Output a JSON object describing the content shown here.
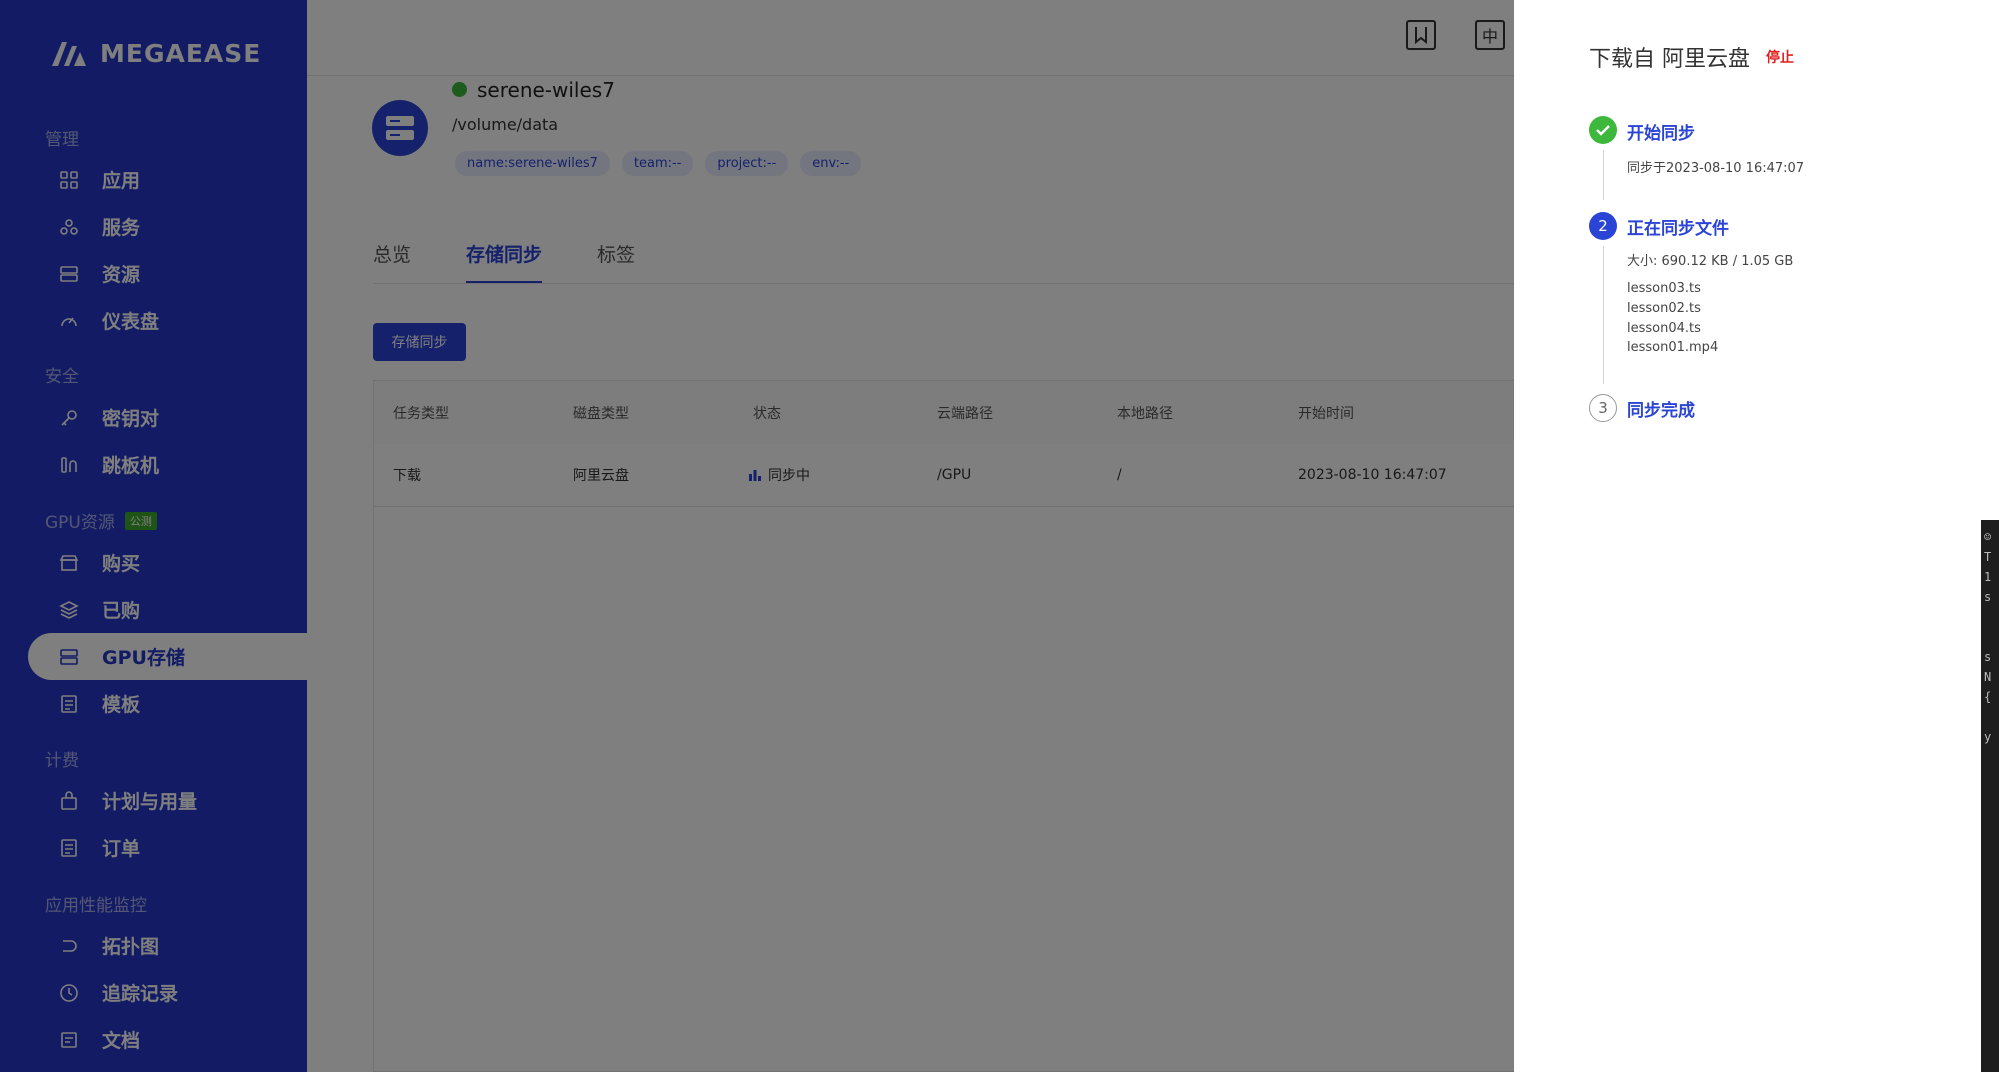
{
  "brand": {
    "name": "MEGAEASE"
  },
  "sidebar": {
    "sections": [
      {
        "label": "管理",
        "items": [
          {
            "label": "应用",
            "icon": "grid-icon"
          },
          {
            "label": "服务",
            "icon": "services-icon"
          },
          {
            "label": "资源",
            "icon": "resource-icon"
          },
          {
            "label": "仪表盘",
            "icon": "dashboard-icon"
          }
        ]
      },
      {
        "label": "安全",
        "items": [
          {
            "label": "密钥对",
            "icon": "key-icon"
          },
          {
            "label": "跳板机",
            "icon": "jump-server-icon"
          }
        ]
      },
      {
        "label": "GPU资源",
        "badge": "公测",
        "items": [
          {
            "label": "购买",
            "icon": "store-icon"
          },
          {
            "label": "已购",
            "icon": "layers-icon"
          },
          {
            "label": "GPU存储",
            "icon": "storage-icon",
            "active": true
          },
          {
            "label": "模板",
            "icon": "template-icon"
          }
        ]
      },
      {
        "label": "计费",
        "items": [
          {
            "label": "计划与用量",
            "icon": "bag-icon"
          },
          {
            "label": "订单",
            "icon": "order-icon"
          }
        ]
      },
      {
        "label": "应用性能监控",
        "items": [
          {
            "label": "拓扑图",
            "icon": "topology-icon"
          },
          {
            "label": "追踪记录",
            "icon": "clock-icon"
          },
          {
            "label": "文档",
            "icon": "doc-icon"
          }
        ]
      }
    ]
  },
  "topbar": {
    "lang_label": "中"
  },
  "resource": {
    "name": "serene-wiles7",
    "path": "/volume/data",
    "status_color": "#3db83d",
    "tags": [
      "name:serene-wiles7",
      "team:--",
      "project:--",
      "env:--"
    ]
  },
  "tabs": [
    {
      "label": "总览"
    },
    {
      "label": "存储同步",
      "active": true
    },
    {
      "label": "标签"
    }
  ],
  "sync_button": "存储同步",
  "table": {
    "columns": [
      "任务类型",
      "磁盘类型",
      "状态",
      "云端路径",
      "本地路径",
      "开始时间"
    ],
    "rows": [
      [
        "下载",
        "阿里云盘",
        "同步中",
        "/GPU",
        "/",
        "2023-08-10 16:47:07"
      ]
    ]
  },
  "drawer": {
    "title": "下载自 阿里云盘",
    "stop_label": "停止",
    "steps": [
      {
        "number": "1",
        "title": "开始同步",
        "status": "done",
        "desc": "同步于2023-08-10 16:47:07"
      },
      {
        "number": "2",
        "title": "正在同步文件",
        "status": "active",
        "desc": "大小:  690.12 KB / 1.05 GB",
        "files": [
          "lesson03.ts",
          "lesson02.ts",
          "lesson04.ts",
          "lesson01.mp4"
        ]
      },
      {
        "number": "3",
        "title": "同步完成",
        "status": "pending"
      }
    ]
  },
  "colors": {
    "sidebar": "#2437c9",
    "accent": "#2a44d6",
    "success": "#3db83d",
    "danger": "#e02020"
  },
  "side_strip_chars": [
    "☺",
    "T",
    "1",
    "s",
    "s",
    "N",
    "{",
    "y"
  ]
}
